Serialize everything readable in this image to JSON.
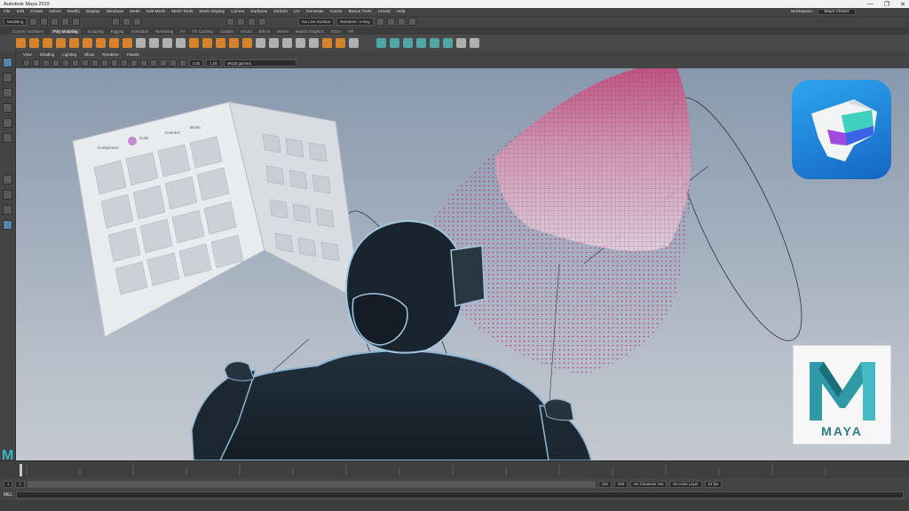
{
  "window": {
    "title": "Autodesk Maya 2019",
    "controls": [
      "—",
      "❐",
      "✕"
    ]
  },
  "menubar": {
    "items": [
      "File",
      "Edit",
      "Create",
      "Select",
      "Modify",
      "Display",
      "Windows",
      "Mesh",
      "Edit Mesh",
      "Mesh Tools",
      "Mesh Display",
      "Curves",
      "Surfaces",
      "Deform",
      "UV",
      "Generate",
      "Cache",
      "Bonus Tools",
      "Arnold",
      "Help"
    ],
    "workspace_label": "Workspace :",
    "workspace_value": "Maya Classic"
  },
  "statusline": {
    "menuset": "Modeling",
    "symmetry": "No Live Surface",
    "render": "Renderer: V-Ray"
  },
  "shelf": {
    "tabs": [
      "Curves / Surfaces",
      "Poly Modeling",
      "Sculpting",
      "Rigging",
      "Animation",
      "Rendering",
      "FX",
      "FX Caching",
      "Custom",
      "Arnold",
      "Bifrost",
      "MASH",
      "Motion Graphics",
      "XGen",
      "VR"
    ],
    "active_tab": "Poly Modeling"
  },
  "panel": {
    "menus": [
      "View",
      "Shading",
      "Lighting",
      "Show",
      "Renderer",
      "Panels"
    ],
    "value_a": "0.00",
    "value_b": "1.00",
    "color_space": "sRGB gamma"
  },
  "vr_panel": {
    "tabs": [
      "Component",
      "Color",
      "Connect",
      "Brush"
    ]
  },
  "range": {
    "start": "1",
    "end": "120",
    "anim_start": "120",
    "anim_end": "200",
    "character_set": "No Character Set",
    "anim_layer": "No Anim Layer",
    "fps": "24 fps"
  },
  "cmdline": {
    "label": "MEL"
  },
  "branding": {
    "maya_word": "MAYA",
    "colors": {
      "teal": "#3bb7c4",
      "accent_blue": "#5285a6",
      "icon_blue": "#1e86dd"
    }
  },
  "icons": [
    "select-tool-icon",
    "lasso-icon",
    "paint-icon",
    "move-icon",
    "rotate-icon",
    "scale-icon",
    "vr-headset-app-icon",
    "maya-logo-icon"
  ]
}
